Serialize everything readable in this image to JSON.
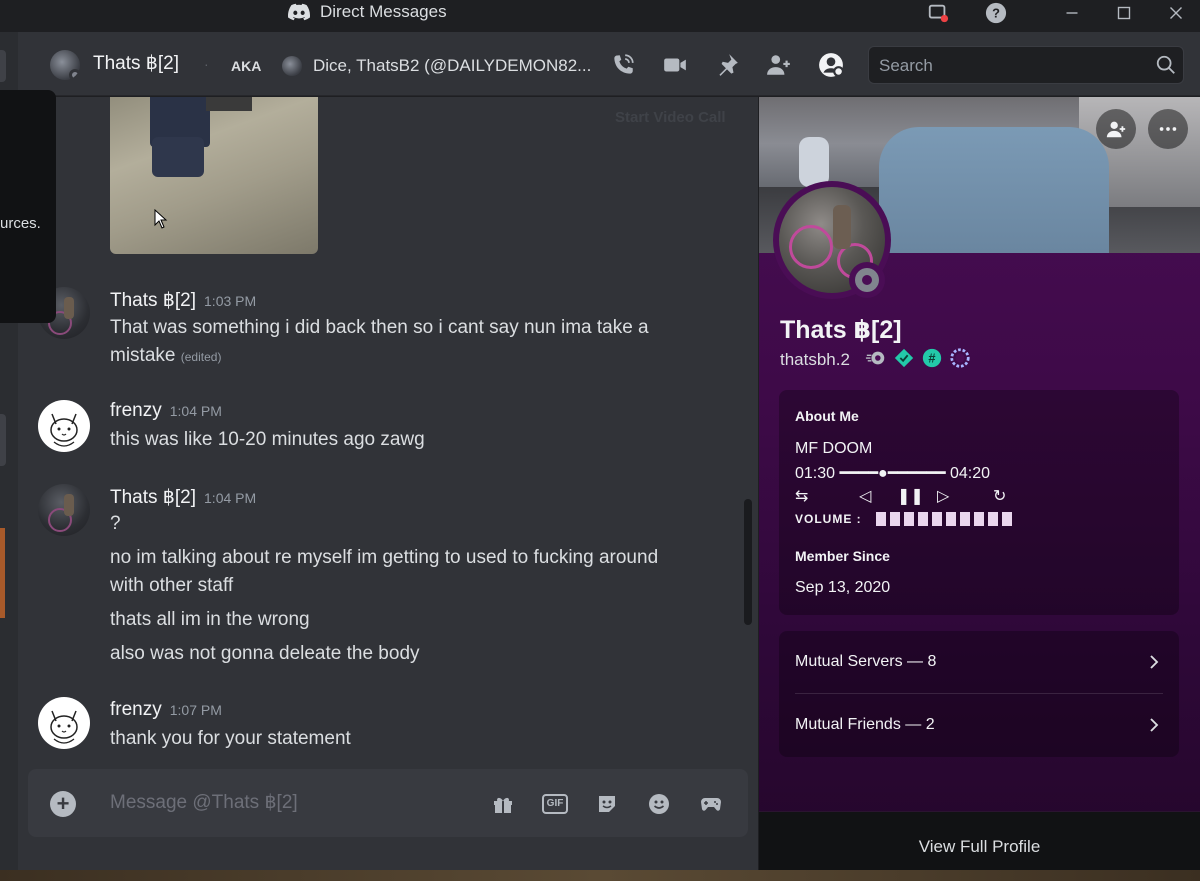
{
  "titlebar": {
    "title": "Direct Messages",
    "icons": [
      "discord-logo-icon",
      "screen-share-icon",
      "help-icon",
      "minimize-icon",
      "maximize-icon",
      "close-icon"
    ]
  },
  "header": {
    "name": "Thats ฿[2]",
    "separator": "·",
    "aka_label": "AKA",
    "aka_names": "Dice, ThatsB2 (@DAILYDEMON82...",
    "search_placeholder": "Search",
    "icons": [
      "voice-call-icon",
      "video-call-icon",
      "pin-icon",
      "add-friends-icon",
      "user-profile-icon",
      "search-icon"
    ]
  },
  "popup": {
    "fragment": "urces."
  },
  "chat": {
    "video_hint": "Start Video Call",
    "messages": [
      {
        "author": "Thats ฿[2]",
        "time": "1:03 PM",
        "lines": [
          "That was something i did back then so i cant say nun ima take a",
          "mistake"
        ],
        "edited": "(edited)"
      },
      {
        "author": "frenzy",
        "time": "1:04 PM",
        "lines": [
          "this was like 10-20 minutes ago zawg"
        ]
      },
      {
        "author": "Thats ฿[2]",
        "time": "1:04 PM",
        "lines": [
          "?",
          "no im talking about re myself im getting to used to fucking around",
          "with other staff",
          "thats all im in the wrong",
          "also was not gonna deleate the body"
        ]
      },
      {
        "author": "frenzy",
        "time": "1:07 PM",
        "lines": [
          "thank you for your statement"
        ]
      }
    ],
    "composer": {
      "placeholder": "Message @Thats ฿[2]",
      "gif_label": "GIF",
      "icons": [
        "plus-icon",
        "gift-icon",
        "gif-icon",
        "sticker-icon",
        "emoji-icon",
        "activity-icon"
      ]
    }
  },
  "profile": {
    "display_name": "Thats ฿[2]",
    "username": "thatsbh.2",
    "badges": [
      "nitro-badge-icon",
      "boost-badge-icon",
      "hashtag-badge-icon",
      "quest-badge-icon"
    ],
    "about_title": "About Me",
    "about_song": "MF DOOM",
    "player_time_start": "01:30",
    "player_track": "━━━━●━━━━━━",
    "player_time_end": "04:20",
    "player_controls": [
      "⇆",
      "◁",
      "❚❚",
      "▷",
      "↻"
    ],
    "volume_label": "VOLUME :",
    "volume_level": 10,
    "member_since_title": "Member Since",
    "member_since": "Sep 13, 2020",
    "mutual_servers": "Mutual Servers — 8",
    "mutual_friends": "Mutual Friends — 2",
    "view_full": "View Full Profile"
  },
  "colors": {
    "background": "#313338",
    "titlebar": "#1e1f22",
    "profile_theme": "#4a0d55",
    "text": "#dbdee1"
  }
}
